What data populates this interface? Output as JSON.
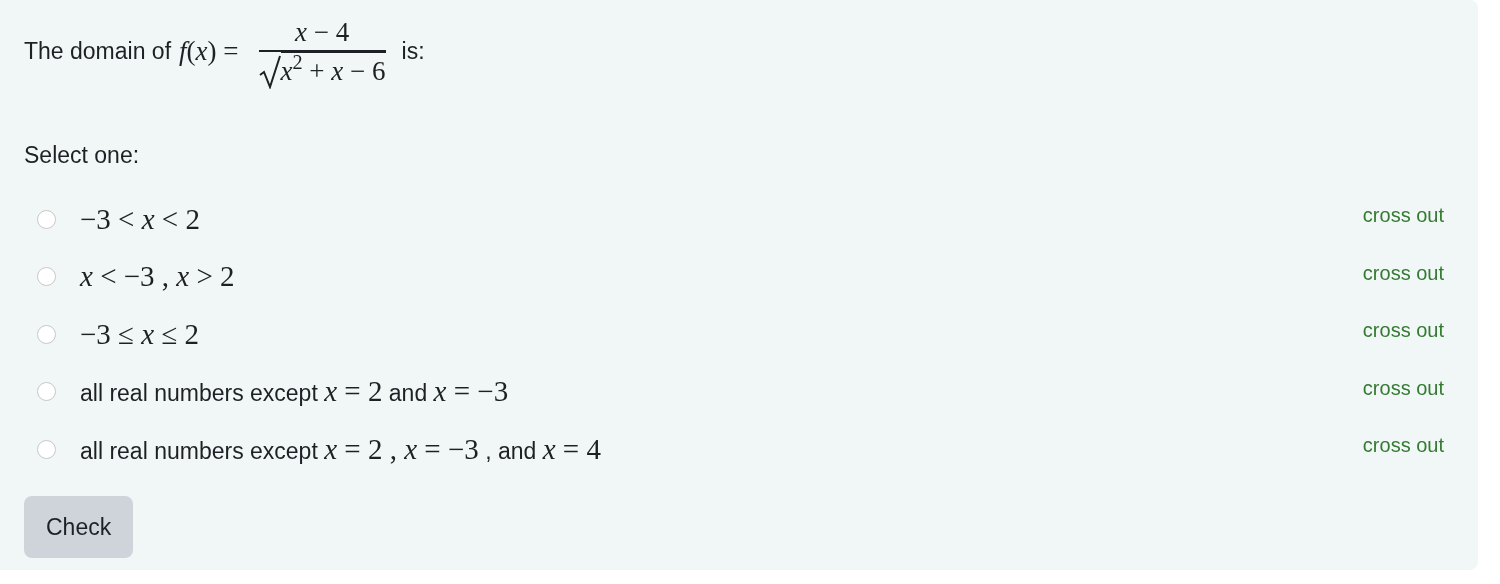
{
  "question": {
    "prefix": "The domain of",
    "lhs": "*f*(*x*) =",
    "numerator": "*x* − 4",
    "radicand": "*x*$^{2}$ + *x* − 6",
    "suffix": "is:"
  },
  "prompt": "Select one:",
  "options": [
    {
      "selected": false,
      "cross_out": "cross out",
      "segments": [
        {
          "kind": "math",
          "text": "−3 < *x* < 2"
        }
      ]
    },
    {
      "selected": false,
      "cross_out": "cross out",
      "segments": [
        {
          "kind": "math",
          "text": "*x* < −3 , *x* > 2"
        }
      ]
    },
    {
      "selected": false,
      "cross_out": "cross out",
      "segments": [
        {
          "kind": "math",
          "text": "−3 ≤ *x* ≤ 2"
        }
      ]
    },
    {
      "selected": false,
      "cross_out": "cross out",
      "segments": [
        {
          "kind": "text",
          "text": "all real numbers except "
        },
        {
          "kind": "math",
          "text": "*x* = 2"
        },
        {
          "kind": "text",
          "text": " and "
        },
        {
          "kind": "math",
          "text": "*x* = −3"
        }
      ]
    },
    {
      "selected": false,
      "cross_out": "cross out",
      "segments": [
        {
          "kind": "text",
          "text": "all real numbers except "
        },
        {
          "kind": "math",
          "text": "*x* = 2 , *x* = −3"
        },
        {
          "kind": "text",
          "text": " , and "
        },
        {
          "kind": "math",
          "text": "*x* = 4"
        }
      ]
    }
  ],
  "check_button": "Check"
}
